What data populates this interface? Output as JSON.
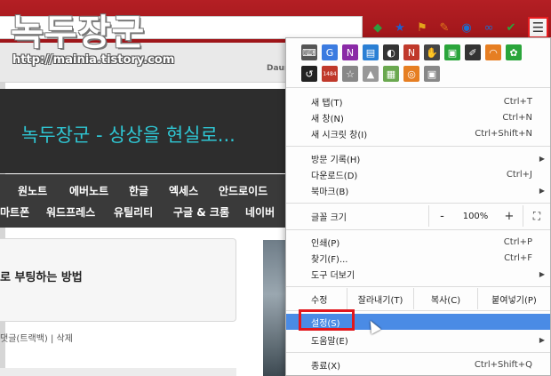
{
  "watermark": {
    "title": "녹두장군",
    "url": "http://mainia.tistory.com"
  },
  "toolbar": {
    "menu_icon": "hamburger-icon",
    "extensions": [
      {
        "icon": "green-diamond-icon",
        "glyph": "◆",
        "color": "#2e9e3f"
      },
      {
        "icon": "star-icon",
        "glyph": "★",
        "color": "#1f5fcf"
      },
      {
        "icon": "yellow-flag-icon",
        "glyph": "⚑",
        "color": "#e3a21b"
      },
      {
        "icon": "feather-icon",
        "glyph": "✎",
        "color": "#e07b1a"
      },
      {
        "icon": "compass-icon",
        "glyph": "◉",
        "color": "#1b6fcf"
      },
      {
        "icon": "link-icon",
        "glyph": "∞",
        "color": "#1b6fcf"
      },
      {
        "icon": "check-icon",
        "glyph": "✔",
        "color": "#2aa53b"
      }
    ]
  },
  "page": {
    "strip_label": "Daum",
    "banner_text": "녹두장군 - 상상을 현실로...",
    "nav_row1": [
      "원노트",
      "에버노트",
      "한글",
      "엑세스",
      "안드로이드"
    ],
    "nav_row2": [
      "마트폰",
      "워드프레스",
      "유틸리티",
      "구글 & 크롬",
      "네이버"
    ],
    "content_title": "로 부팅하는 방법",
    "content_meta": "댓글(트랙백) | 삭제"
  },
  "menu": {
    "ext_row1": [
      {
        "icon": "keyboard-icon",
        "glyph": "⌨",
        "color": "#555"
      },
      {
        "icon": "translate-icon",
        "glyph": "G",
        "color": "#3b7be0"
      },
      {
        "icon": "onenote-icon",
        "glyph": "N",
        "color": "#8a2aa6"
      },
      {
        "icon": "document-icon",
        "glyph": "▤",
        "color": "#2a7fd4"
      },
      {
        "icon": "mask-icon",
        "glyph": "◐",
        "color": "#333"
      },
      {
        "icon": "new-badge-icon",
        "glyph": "N",
        "color": "#c0392b"
      },
      {
        "icon": "hand-icon",
        "glyph": "✋",
        "color": "#444"
      },
      {
        "icon": "camera-icon",
        "glyph": "▣",
        "color": "#2aa53b"
      },
      {
        "icon": "eyedropper-icon",
        "glyph": "✐",
        "color": "#333"
      },
      {
        "icon": "rainbow-icon",
        "glyph": "◠",
        "color": "#e67e22"
      },
      {
        "icon": "evernote-icon",
        "glyph": "✿",
        "color": "#2aa53b"
      }
    ],
    "ext_row2": [
      {
        "icon": "undo-icon",
        "glyph": "↺",
        "color": "#222"
      },
      {
        "icon": "badge-1484-icon",
        "glyph": "1484",
        "color": "#c0392b"
      },
      {
        "icon": "star-outline-icon",
        "glyph": "☆",
        "color": "#888"
      },
      {
        "icon": "drive-icon",
        "glyph": "▲",
        "color": "#999"
      },
      {
        "icon": "image-icon",
        "glyph": "▦",
        "color": "#6aa84f"
      },
      {
        "icon": "rss-icon",
        "glyph": "◎",
        "color": "#e67e22"
      },
      {
        "icon": "grid-icon",
        "glyph": "▣",
        "color": "#888"
      }
    ],
    "new_tab": {
      "label": "새 탭(T)",
      "shortcut": "Ctrl+T"
    },
    "new_window": {
      "label": "새 창(N)",
      "shortcut": "Ctrl+N"
    },
    "incognito": {
      "label": "새 시크릿 창(I)",
      "shortcut": "Ctrl+Shift+N"
    },
    "history": {
      "label": "방문 기록(H)"
    },
    "downloads": {
      "label": "다운로드(D)",
      "shortcut": "Ctrl+J"
    },
    "bookmarks": {
      "label": "북마크(B)"
    },
    "zoom": {
      "label": "글꼴 크기",
      "minus": "-",
      "value": "100%",
      "plus": "+",
      "fullscreen_icon": "fullscreen-icon"
    },
    "print": {
      "label": "인쇄(P)",
      "shortcut": "Ctrl+P"
    },
    "find": {
      "label": "찾기(F)...",
      "shortcut": "Ctrl+F"
    },
    "more_tools": {
      "label": "도구 더보기"
    },
    "edit": {
      "label": "수정",
      "cut": "잘라내기(T)",
      "copy": "복사(C)",
      "paste": "붙여넣기(P)"
    },
    "settings": {
      "label": "설정(S)"
    },
    "help": {
      "label": "도움말(E)"
    },
    "exit": {
      "label": "종료(X)",
      "shortcut": "Ctrl+Shift+Q"
    }
  }
}
